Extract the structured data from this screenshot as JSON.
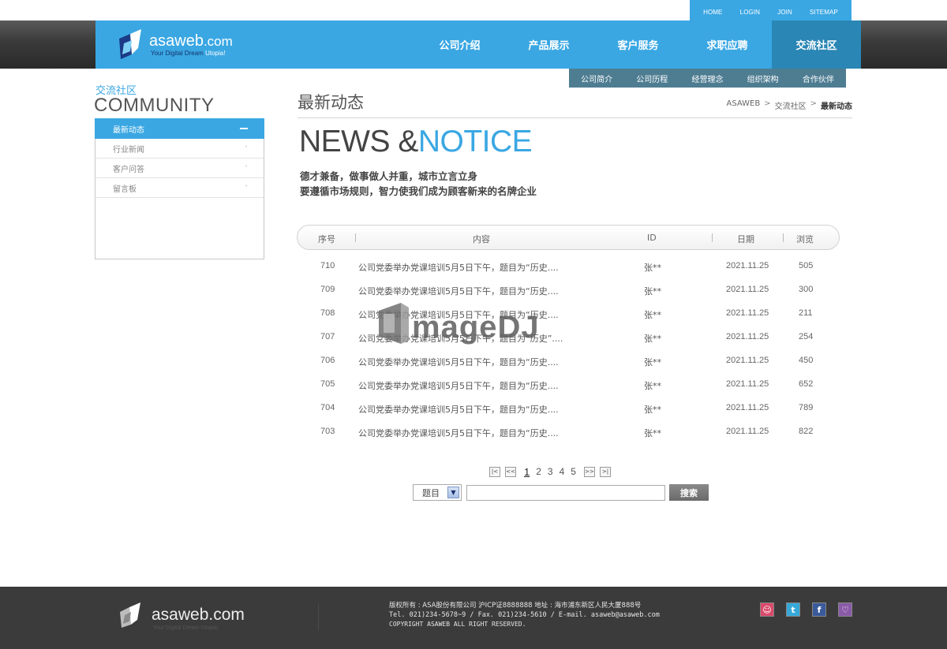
{
  "utility_nav": [
    "HOME",
    "LOGIN",
    "JOIN",
    "SITEMAP"
  ],
  "logo": {
    "name": "asaweb",
    "suffix": ".com",
    "slogan_a": "Your Digital Dream",
    "slogan_b": "Utopia!"
  },
  "main_nav": [
    {
      "label": "公司介绍",
      "active": false
    },
    {
      "label": "产品展示",
      "active": false
    },
    {
      "label": "客户服务",
      "active": false
    },
    {
      "label": "求职应聘",
      "active": false
    },
    {
      "label": "交流社区",
      "active": true
    }
  ],
  "sub_nav": [
    "公司简介",
    "公司历程",
    "经营理念",
    "组织架构",
    "合作伙伴"
  ],
  "sidebar": {
    "title_cn": "交流社区",
    "title_en": "COMMUNITY",
    "items": [
      {
        "label": "最新动态",
        "active": true
      },
      {
        "label": "行业新闻",
        "active": false
      },
      {
        "label": "客户问答",
        "active": false
      },
      {
        "label": "留言板",
        "active": false
      }
    ]
  },
  "page_title": "最新动态",
  "breadcrumb": [
    "ASAWEB",
    "交流社区",
    "最新动态"
  ],
  "hero": {
    "part1": "NEWS &",
    "part2": "NOTICE"
  },
  "tagline": [
    "德才兼备，做事做人并重，城市立言立身",
    "要遵循市场规则，智力使我们成为顾客新来的名牌企业"
  ],
  "table": {
    "headers": {
      "no": "序号",
      "title": "内容",
      "author": "ID",
      "date": "日期",
      "views": "浏览"
    },
    "rows": [
      {
        "no": "710",
        "title": "公司党委举办党课培训5月5日下午，题目为“历史....",
        "author": "张**",
        "date": "2021.11.25",
        "views": "505"
      },
      {
        "no": "709",
        "title": "公司党委举办党课培训5月5日下午，题目为“历史....",
        "author": "张**",
        "date": "2021.11.25",
        "views": "300"
      },
      {
        "no": "708",
        "title": "公司党委举办党课培训5月5日下午，题目为“历史....",
        "author": "张**",
        "date": "2021.11.25",
        "views": "211"
      },
      {
        "no": "707",
        "title": "公司党委举办党课培训5月5日下午，题目为“历史”....",
        "author": "张**",
        "date": "2021.11.25",
        "views": "254"
      },
      {
        "no": "706",
        "title": "公司党委举办党课培训5月5日下午，题目为“历史....",
        "author": "张**",
        "date": "2021.11.25",
        "views": "450"
      },
      {
        "no": "705",
        "title": "公司党委举办党课培训5月5日下午，题目为“历史....",
        "author": "张**",
        "date": "2021.11.25",
        "views": "652"
      },
      {
        "no": "704",
        "title": "公司党委举办党课培训5月5日下午，题目为“历史....",
        "author": "张**",
        "date": "2021.11.25",
        "views": "789"
      },
      {
        "no": "703",
        "title": "公司党委举办党课培训5月5日下午，题目为“历史....",
        "author": "张**",
        "date": "2021.11.25",
        "views": "822"
      }
    ]
  },
  "pagination": {
    "pages": [
      "1",
      "2",
      "3",
      "4",
      "5"
    ],
    "current": "1"
  },
  "search": {
    "select_value": "题目",
    "input_value": "",
    "button": "搜索"
  },
  "watermark_text": "imageDJ",
  "footer": {
    "logo_name": "asaweb",
    "logo_suffix": ".com",
    "logo_slogan": "Your Digital Dream Utopia!",
    "line1": "版权所有 : ASA股份有限公司 沪ICP证8888888   地址 : 海市浦东新区人民大厦888号",
    "line2": "Tel. 021)234-5678~9  / Fax. 021)234-5610  / E-mail. asaweb@asaweb.com",
    "line3": "COPYRIGHT ASAWEB ALL RIGHT RESERVED.",
    "social_icons": [
      "weibo-icon",
      "twitter-icon",
      "facebook-icon",
      "chat-icon"
    ]
  },
  "colors": {
    "accent": "#3aa7e3",
    "nav_active": "#2a86b5",
    "subnav": "#4e7d92",
    "footer": "#3b3b3b"
  }
}
